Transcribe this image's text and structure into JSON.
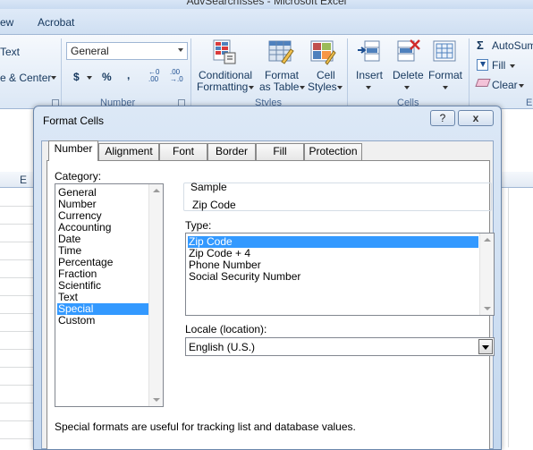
{
  "app": {
    "window_title": "AdvSearchIsses - Microsoft Excel"
  },
  "ribbon_tabs": [
    "ew",
    "Acrobat"
  ],
  "ribbon": {
    "alignment": {
      "wrap_text": "Text",
      "merge_center": "e & Center"
    },
    "number": {
      "format_value": "General",
      "currency_symbol": "$",
      "percent_symbol": "%",
      "comma_symbol": ",",
      "group_label": "Number"
    },
    "styles": {
      "conditional_formatting": [
        "Conditional",
        "Formatting"
      ],
      "format_as_table": [
        "Format",
        "as Table"
      ],
      "cell_styles": [
        "Cell",
        "Styles"
      ],
      "group_label": "Styles"
    },
    "cells": {
      "insert": "Insert",
      "delete": "Delete",
      "format": "Format",
      "group_label": "Cells"
    },
    "editing": {
      "autosum": "AutoSum",
      "fill": "Fill",
      "clear": "Clear"
    }
  },
  "sheet": {
    "column_header": "E"
  },
  "dialog": {
    "title": "Format Cells",
    "help_button": "?",
    "close_button": "x",
    "tabs": [
      "Number",
      "Alignment",
      "Font",
      "Border",
      "Fill",
      "Protection"
    ],
    "active_tab": "Number",
    "category_label": "Category:",
    "categories": [
      "General",
      "Number",
      "Currency",
      "Accounting",
      "Date",
      "Time",
      "Percentage",
      "Fraction",
      "Scientific",
      "Text",
      "Special",
      "Custom"
    ],
    "selected_category": "Special",
    "sample_label": "Sample",
    "sample_value": "Zip Code",
    "type_label": "Type:",
    "types": [
      "Zip Code",
      "Zip Code + 4",
      "Phone Number",
      "Social Security Number"
    ],
    "selected_type": "Zip Code",
    "locale_label": "Locale (location):",
    "locale_value": "English (U.S.)",
    "description": "Special formats are useful for tracking list and database values."
  }
}
